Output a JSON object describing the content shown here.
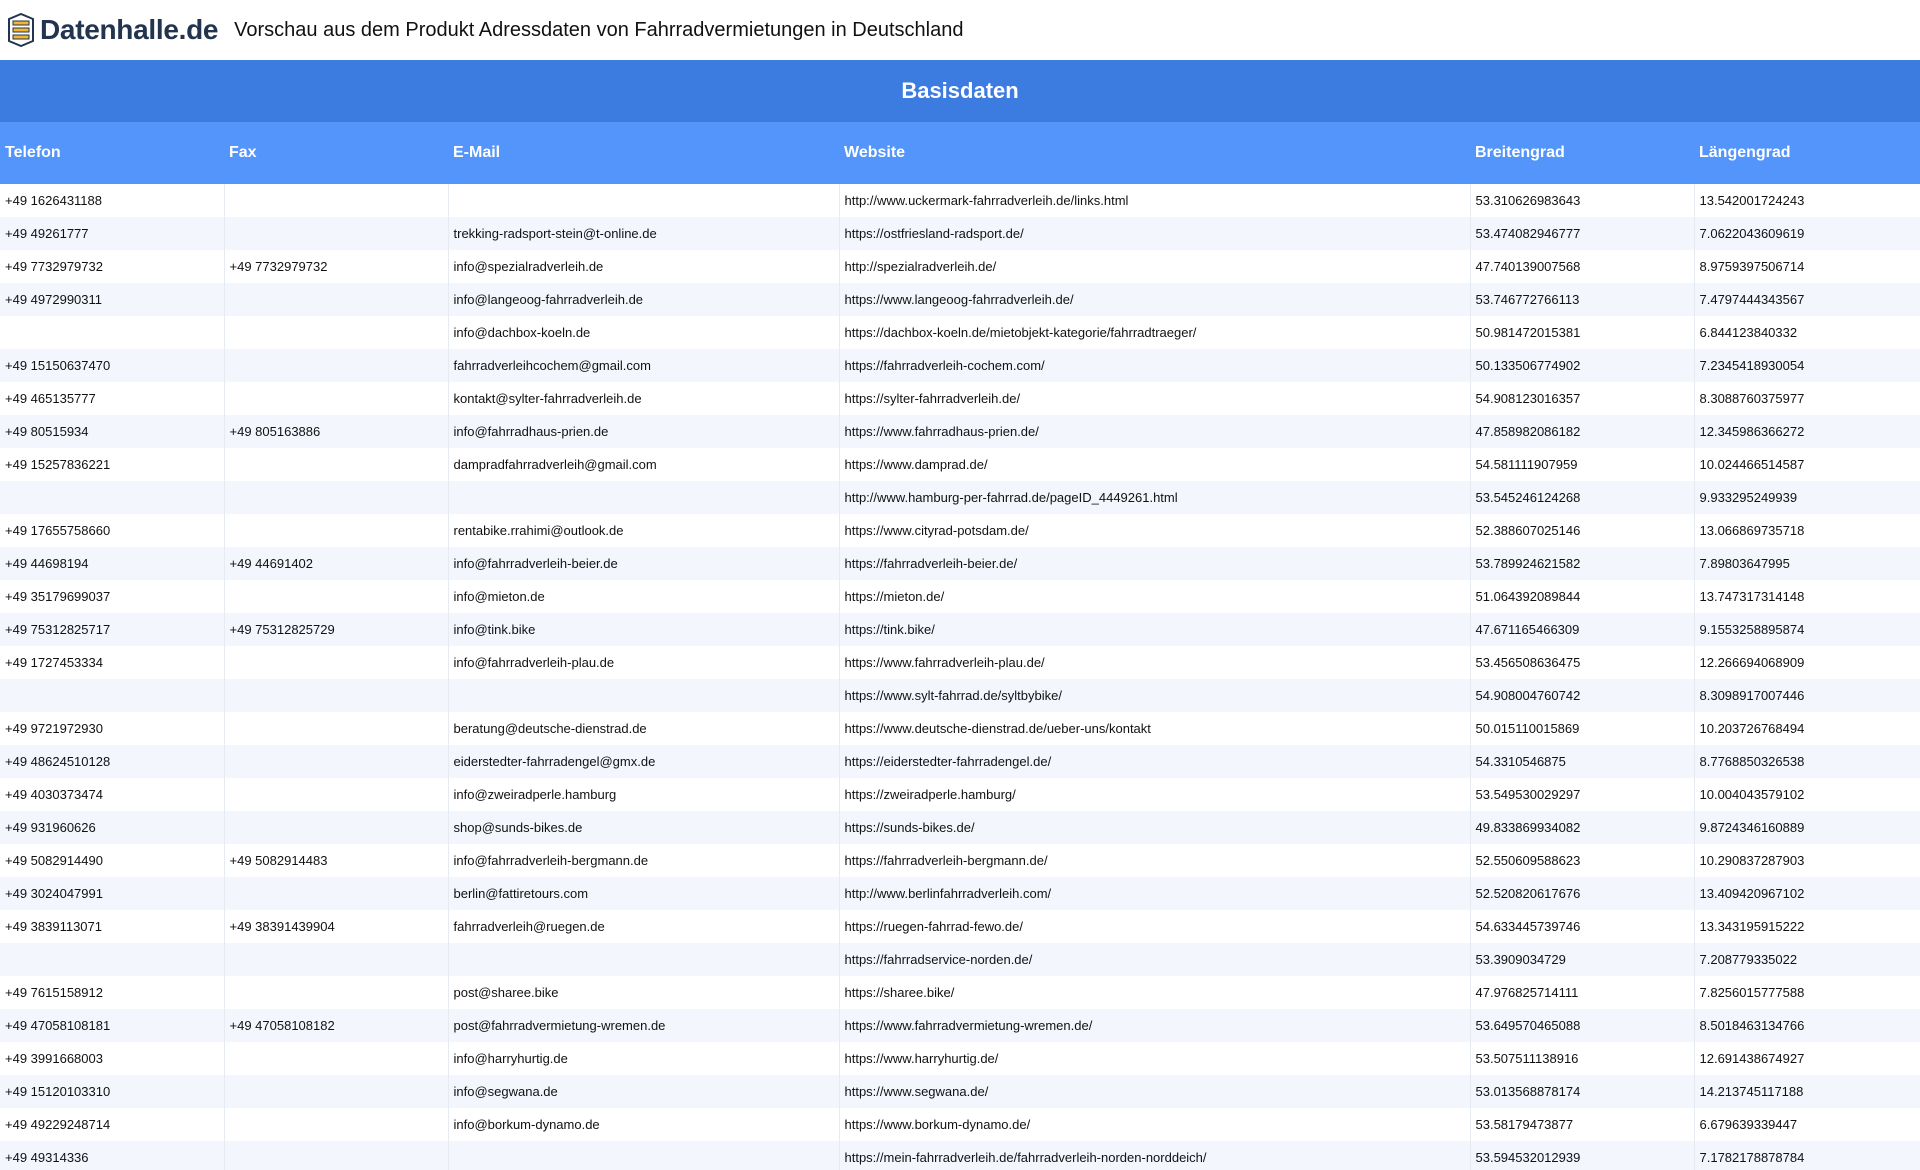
{
  "header": {
    "logo_text": "Datenhalle.de",
    "title": "Vorschau aus dem Produkt Adressdaten von Fahrradvermietungen in Deutschland"
  },
  "colors": {
    "group_header_bg": "#3c7be0",
    "column_header_bg": "#5395fb",
    "row_alt_bg": "#f3f7fd",
    "logo_text": "#22344e"
  },
  "table": {
    "group_title": "Basisdaten",
    "columns": [
      "Telefon",
      "Fax",
      "E-Mail",
      "Website",
      "Breitengrad",
      "Längengrad"
    ],
    "rows": [
      [
        "+49 1626431188",
        "",
        "",
        "http://www.uckermark-fahrradverleih.de/links.html",
        "53.310626983643",
        "13.542001724243"
      ],
      [
        "+49 49261777",
        "",
        "trekking-radsport-stein@t-online.de",
        "https://ostfriesland-radsport.de/",
        "53.474082946777",
        "7.0622043609619"
      ],
      [
        "+49 7732979732",
        "+49 7732979732",
        "info@spezialradverleih.de",
        "http://spezialradverleih.de/",
        "47.740139007568",
        "8.9759397506714"
      ],
      [
        "+49 4972990311",
        "",
        "info@langeoog-fahrradverleih.de",
        "https://www.langeoog-fahrradverleih.de/",
        "53.746772766113",
        "7.4797444343567"
      ],
      [
        "",
        "",
        "info@dachbox-koeln.de",
        "https://dachbox-koeln.de/mietobjekt-kategorie/fahrradtraeger/",
        "50.981472015381",
        "6.844123840332"
      ],
      [
        "+49 15150637470",
        "",
        "fahrradverleihcochem@gmail.com",
        "https://fahrradverleih-cochem.com/",
        "50.133506774902",
        "7.2345418930054"
      ],
      [
        "+49 465135777",
        "",
        "kontakt@sylter-fahrradverleih.de",
        "https://sylter-fahrradverleih.de/",
        "54.908123016357",
        "8.3088760375977"
      ],
      [
        "+49 80515934",
        "+49 805163886",
        "info@fahrradhaus-prien.de",
        "https://www.fahrradhaus-prien.de/",
        "47.858982086182",
        "12.345986366272"
      ],
      [
        "+49 15257836221",
        "",
        "dampradfahrradverleih@gmail.com",
        "https://www.damprad.de/",
        "54.581111907959",
        "10.024466514587"
      ],
      [
        "",
        "",
        "",
        "http://www.hamburg-per-fahrrad.de/pageID_4449261.html",
        "53.545246124268",
        "9.933295249939"
      ],
      [
        "+49 17655758660",
        "",
        "rentabike.rrahimi@outlook.de",
        "https://www.cityrad-potsdam.de/",
        "52.388607025146",
        "13.066869735718"
      ],
      [
        "+49 44698194",
        "+49 44691402",
        "info@fahrradverleih-beier.de",
        "https://fahrradverleih-beier.de/",
        "53.789924621582",
        "7.89803647995"
      ],
      [
        "+49 35179699037",
        "",
        "info@mieton.de",
        "https://mieton.de/",
        "51.064392089844",
        "13.747317314148"
      ],
      [
        "+49 75312825717",
        "+49 75312825729",
        "info@tink.bike",
        "https://tink.bike/",
        "47.671165466309",
        "9.1553258895874"
      ],
      [
        "+49 1727453334",
        "",
        "info@fahrradverleih-plau.de",
        "https://www.fahrradverleih-plau.de/",
        "53.456508636475",
        "12.266694068909"
      ],
      [
        "",
        "",
        "",
        "https://www.sylt-fahrrad.de/syltbybike/",
        "54.908004760742",
        "8.3098917007446"
      ],
      [
        "+49 9721972930",
        "",
        "beratung@deutsche-dienstrad.de",
        "https://www.deutsche-dienstrad.de/ueber-uns/kontakt",
        "50.015110015869",
        "10.203726768494"
      ],
      [
        "+49 48624510128",
        "",
        "eiderstedter-fahrradengel@gmx.de",
        "https://eiderstedter-fahrradengel.de/",
        "54.3310546875",
        "8.7768850326538"
      ],
      [
        "+49 4030373474",
        "",
        "info@zweiradperle.hamburg",
        "https://zweiradperle.hamburg/",
        "53.549530029297",
        "10.004043579102"
      ],
      [
        "+49 931960626",
        "",
        "shop@sunds-bikes.de",
        "https://sunds-bikes.de/",
        "49.833869934082",
        "9.8724346160889"
      ],
      [
        "+49 5082914490",
        "+49 5082914483",
        "info@fahrradverleih-bergmann.de",
        "https://fahrradverleih-bergmann.de/",
        "52.550609588623",
        "10.290837287903"
      ],
      [
        "+49 3024047991",
        "",
        "berlin@fattiretours.com",
        "http://www.berlinfahrradverleih.com/",
        "52.520820617676",
        "13.409420967102"
      ],
      [
        "+49 3839113071",
        "+49 38391439904",
        "fahrradverleih@ruegen.de",
        "https://ruegen-fahrrad-fewo.de/",
        "54.633445739746",
        "13.343195915222"
      ],
      [
        "",
        "",
        "",
        "https://fahrradservice-norden.de/",
        "53.3909034729",
        "7.208779335022"
      ],
      [
        "+49 7615158912",
        "",
        "post@sharee.bike",
        "https://sharee.bike/",
        "47.976825714111",
        "7.8256015777588"
      ],
      [
        "+49 47058108181",
        "+49 47058108182",
        "post@fahrradvermietung-wremen.de",
        "https://www.fahrradvermietung-wremen.de/",
        "53.649570465088",
        "8.5018463134766"
      ],
      [
        "+49 3991668003",
        "",
        "info@harryhurtig.de",
        "https://www.harryhurtig.de/",
        "53.507511138916",
        "12.691438674927"
      ],
      [
        "+49 15120103310",
        "",
        "info@segwana.de",
        "https://www.segwana.de/",
        "53.013568878174",
        "14.213745117188"
      ],
      [
        "+49 49229248714",
        "",
        "info@borkum-dynamo.de",
        "https://www.borkum-dynamo.de/",
        "53.58179473877",
        "6.679639339447"
      ],
      [
        "+49 49314336",
        "",
        "",
        "https://mein-fahrradverleih.de/fahrradverleih-norden-norddeich/",
        "53.594532012939",
        "7.1782178878784"
      ]
    ]
  }
}
